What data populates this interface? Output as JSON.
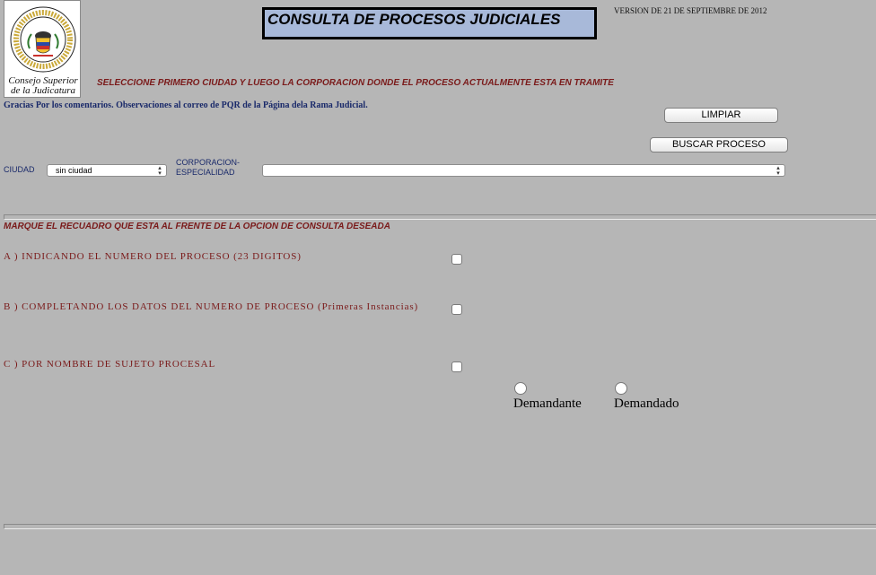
{
  "header": {
    "logo_ring_text": "Rama Judicial · República de Colombia",
    "logo_caption_line1": "Consejo Superior",
    "logo_caption_line2": "de la Judicatura",
    "title": "CONSULTA DE PROCESOS JUDICIALES",
    "version": "VERSION DE 21 DE SEPTIEMBRE DE 2012"
  },
  "instruction": "SELECCIONE PRIMERO CIUDAD Y LUEGO LA CORPORACION DONDE EL PROCESO ACTUALMENTE ESTA EN TRAMITE",
  "thanks": "Gracias Por los comentarios. Observaciones al correo de PQR de la Página dela Rama Judicial.",
  "buttons": {
    "clear": "LIMPIAR",
    "search": "BUSCAR PROCESO"
  },
  "filters": {
    "city_label": "CIUDAD",
    "city_value": "sin ciudad",
    "corp_label_line1": "CORPORACION-",
    "corp_label_line2": "ESPECIALIDAD",
    "corp_value": ""
  },
  "options_heading": "MARQUE EL RECUADRO QUE ESTA AL FRENTE DE LA OPCION DE CONSULTA DESEADA",
  "options": {
    "a": "A ) INDICANDO EL NUMERO DEL PROCESO (23 DIGITOS)",
    "b": "B ) COMPLETANDO LOS DATOS DEL NUMERO DE PROCESO (Primeras Instancias)",
    "c": "C ) POR NOMBRE DE SUJETO PROCESAL"
  },
  "party_type": {
    "plaintiff": "Demandante",
    "defendant": "Demandado"
  },
  "colors": {
    "background": "#b6b6b6",
    "title_fill": "#a8b9d9",
    "accent_red": "#7a1a1a",
    "accent_blue": "#1a2a6a"
  },
  "icons": [
    "coat-of-arms-icon",
    "select-arrows-icon"
  ]
}
